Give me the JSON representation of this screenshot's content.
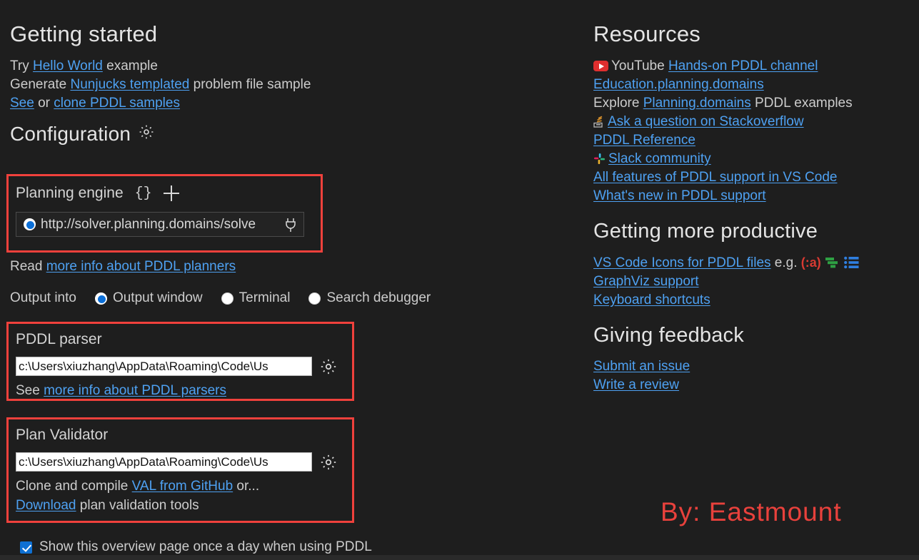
{
  "theme": {
    "background": "#1e1e1e",
    "text": "#cccccc",
    "link": "#4ea1f2",
    "annotation_box": "#f0413c",
    "accent_blue": "#0e70d3",
    "byline_color": "#e8413c"
  },
  "getting_started": {
    "heading": "Getting started",
    "lines": [
      {
        "pre": "Try ",
        "link": "Hello World",
        "post": " example"
      },
      {
        "pre": "Generate ",
        "link": "Nunjucks templated",
        "post": " problem file sample"
      },
      {
        "pre": "",
        "link": "See",
        "mid": " or ",
        "link2": "clone PDDL samples",
        "post": ""
      }
    ]
  },
  "configuration": {
    "heading": "Configuration",
    "gear_icon": "gear-icon",
    "planning_engine": {
      "title": "Planning engine",
      "braces_icon": "{}",
      "add_icon": "plus-icon",
      "selected_engine": "http://solver.planning.domains/solve",
      "engine_radio_checked": true,
      "plug_icon": "plug-icon"
    },
    "read_line": {
      "pre": "Read ",
      "link": "more info about PDDL planners"
    },
    "output_into": {
      "label": "Output into",
      "options": [
        {
          "label": "Output window",
          "selected": true
        },
        {
          "label": "Terminal",
          "selected": false
        },
        {
          "label": "Search debugger",
          "selected": false
        }
      ]
    },
    "pddl_parser": {
      "title": "PDDL parser",
      "path_value": "c:\\Users\\xiuzhang\\AppData\\Roaming\\Code\\Us",
      "gear_icon": "gear-icon",
      "sub": {
        "pre": "See ",
        "link": "more info about PDDL parsers"
      }
    },
    "plan_validator": {
      "title": "Plan Validator",
      "path_value": "c:\\Users\\xiuzhang\\AppData\\Roaming\\Code\\Us",
      "gear_icon": "gear-icon",
      "sub1": {
        "pre": "Clone and compile ",
        "link": "VAL from GitHub",
        "post": " or..."
      },
      "sub2": {
        "link": "Download",
        "post": " plan validation tools"
      }
    }
  },
  "show_overview": {
    "label": "Show this overview page once a day when using PDDL",
    "checked": true
  },
  "resources": {
    "heading": "Resources",
    "youtube_label": "YouTube",
    "youtube_link": "Hands-on PDDL channel",
    "education_link": "Education.planning.domains",
    "explore_pre": "Explore ",
    "explore_link": "Planning.domains",
    "explore_post": " PDDL examples",
    "stackoverflow_link": "Ask a question on Stackoverflow",
    "pddl_reference_link": "PDDL Reference",
    "slack_link": "Slack community",
    "all_features_link": "All features of PDDL support in VS Code",
    "whats_new_link": "What's new in PDDL support"
  },
  "productive": {
    "heading": "Getting more productive",
    "icons_link": "VS Code Icons for PDDL files",
    "icons_eg": "e.g.",
    "icon_a": "(:a)",
    "icon_gantt": "gantt-icon",
    "icon_list": "list-icon",
    "graphviz_link": "GraphViz support",
    "keyboard_link": "Keyboard shortcuts"
  },
  "feedback": {
    "heading": "Giving feedback",
    "submit_link": "Submit an issue",
    "review_link": "Write a review"
  },
  "byline": {
    "text": "By: Eastmount"
  }
}
